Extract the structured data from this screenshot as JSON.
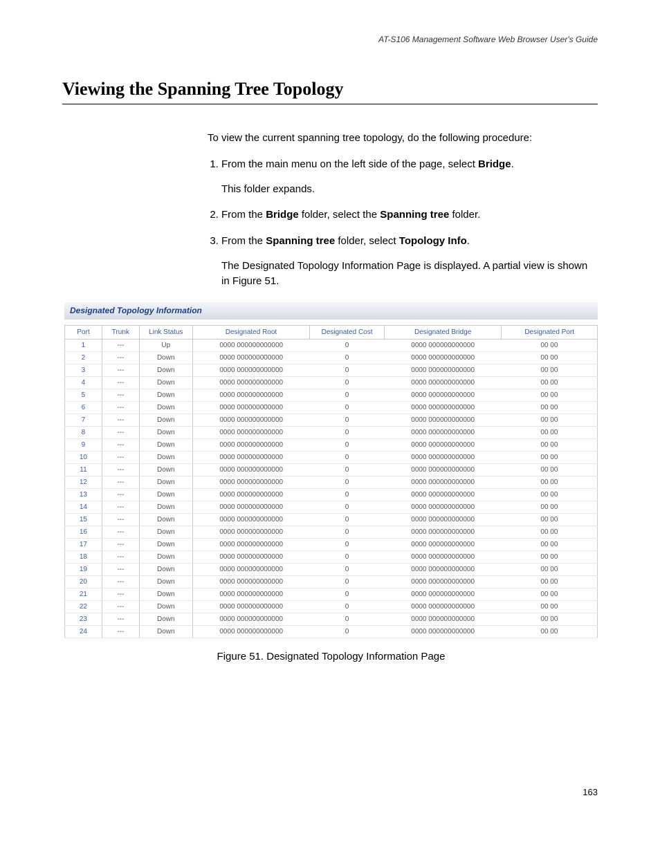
{
  "header": {
    "guide_title": "AT-S106 Management Software Web Browser User's Guide"
  },
  "section": {
    "heading": "Viewing the Spanning Tree Topology"
  },
  "intro": "To view the current spanning tree topology, do the following procedure:",
  "steps": {
    "s1_a": "From the main menu on the left side of the page, select ",
    "s1_b": "Bridge",
    "s1_c": ".",
    "s1_sub": "This folder expands.",
    "s2_a": "From the ",
    "s2_b": "Bridge",
    "s2_c": " folder, select the ",
    "s2_d": "Spanning tree",
    "s2_e": " folder.",
    "s3_a": "From the ",
    "s3_b": "Spanning tree",
    "s3_c": " folder, select ",
    "s3_d": "Topology Info",
    "s3_e": ".",
    "s3_sub": "The Designated Topology Information Page is displayed. A partial view is shown in Figure 51."
  },
  "figure": {
    "panel_title": "Designated Topology Information",
    "caption": "Figure 51. Designated Topology Information Page"
  },
  "table": {
    "headers": {
      "port": "Port",
      "trunk": "Trunk",
      "link_status": "Link Status",
      "designated_root": "Designated Root",
      "designated_cost": "Designated Cost",
      "designated_bridge": "Designated Bridge",
      "designated_port": "Designated Port"
    },
    "rows": [
      {
        "port": "1",
        "trunk": "---",
        "link": "Up",
        "root": "0000 000000000000",
        "cost": "0",
        "bridge": "0000 000000000000",
        "dport": "00 00"
      },
      {
        "port": "2",
        "trunk": "---",
        "link": "Down",
        "root": "0000 000000000000",
        "cost": "0",
        "bridge": "0000 000000000000",
        "dport": "00 00"
      },
      {
        "port": "3",
        "trunk": "---",
        "link": "Down",
        "root": "0000 000000000000",
        "cost": "0",
        "bridge": "0000 000000000000",
        "dport": "00 00"
      },
      {
        "port": "4",
        "trunk": "---",
        "link": "Down",
        "root": "0000 000000000000",
        "cost": "0",
        "bridge": "0000 000000000000",
        "dport": "00 00"
      },
      {
        "port": "5",
        "trunk": "---",
        "link": "Down",
        "root": "0000 000000000000",
        "cost": "0",
        "bridge": "0000 000000000000",
        "dport": "00 00"
      },
      {
        "port": "6",
        "trunk": "---",
        "link": "Down",
        "root": "0000 000000000000",
        "cost": "0",
        "bridge": "0000 000000000000",
        "dport": "00 00"
      },
      {
        "port": "7",
        "trunk": "---",
        "link": "Down",
        "root": "0000 000000000000",
        "cost": "0",
        "bridge": "0000 000000000000",
        "dport": "00 00"
      },
      {
        "port": "8",
        "trunk": "---",
        "link": "Down",
        "root": "0000 000000000000",
        "cost": "0",
        "bridge": "0000 000000000000",
        "dport": "00 00"
      },
      {
        "port": "9",
        "trunk": "---",
        "link": "Down",
        "root": "0000 000000000000",
        "cost": "0",
        "bridge": "0000 000000000000",
        "dport": "00 00"
      },
      {
        "port": "10",
        "trunk": "---",
        "link": "Down",
        "root": "0000 000000000000",
        "cost": "0",
        "bridge": "0000 000000000000",
        "dport": "00 00"
      },
      {
        "port": "11",
        "trunk": "---",
        "link": "Down",
        "root": "0000 000000000000",
        "cost": "0",
        "bridge": "0000 000000000000",
        "dport": "00 00"
      },
      {
        "port": "12",
        "trunk": "---",
        "link": "Down",
        "root": "0000 000000000000",
        "cost": "0",
        "bridge": "0000 000000000000",
        "dport": "00 00"
      },
      {
        "port": "13",
        "trunk": "---",
        "link": "Down",
        "root": "0000 000000000000",
        "cost": "0",
        "bridge": "0000 000000000000",
        "dport": "00 00"
      },
      {
        "port": "14",
        "trunk": "---",
        "link": "Down",
        "root": "0000 000000000000",
        "cost": "0",
        "bridge": "0000 000000000000",
        "dport": "00 00"
      },
      {
        "port": "15",
        "trunk": "---",
        "link": "Down",
        "root": "0000 000000000000",
        "cost": "0",
        "bridge": "0000 000000000000",
        "dport": "00 00"
      },
      {
        "port": "16",
        "trunk": "---",
        "link": "Down",
        "root": "0000 000000000000",
        "cost": "0",
        "bridge": "0000 000000000000",
        "dport": "00 00"
      },
      {
        "port": "17",
        "trunk": "---",
        "link": "Down",
        "root": "0000 000000000000",
        "cost": "0",
        "bridge": "0000 000000000000",
        "dport": "00 00"
      },
      {
        "port": "18",
        "trunk": "---",
        "link": "Down",
        "root": "0000 000000000000",
        "cost": "0",
        "bridge": "0000 000000000000",
        "dport": "00 00"
      },
      {
        "port": "19",
        "trunk": "---",
        "link": "Down",
        "root": "0000 000000000000",
        "cost": "0",
        "bridge": "0000 000000000000",
        "dport": "00 00"
      },
      {
        "port": "20",
        "trunk": "---",
        "link": "Down",
        "root": "0000 000000000000",
        "cost": "0",
        "bridge": "0000 000000000000",
        "dport": "00 00"
      },
      {
        "port": "21",
        "trunk": "---",
        "link": "Down",
        "root": "0000 000000000000",
        "cost": "0",
        "bridge": "0000 000000000000",
        "dport": "00 00"
      },
      {
        "port": "22",
        "trunk": "---",
        "link": "Down",
        "root": "0000 000000000000",
        "cost": "0",
        "bridge": "0000 000000000000",
        "dport": "00 00"
      },
      {
        "port": "23",
        "trunk": "---",
        "link": "Down",
        "root": "0000 000000000000",
        "cost": "0",
        "bridge": "0000 000000000000",
        "dport": "00 00"
      },
      {
        "port": "24",
        "trunk": "---",
        "link": "Down",
        "root": "0000 000000000000",
        "cost": "0",
        "bridge": "0000 000000000000",
        "dport": "00 00"
      }
    ]
  },
  "page_number": "163"
}
